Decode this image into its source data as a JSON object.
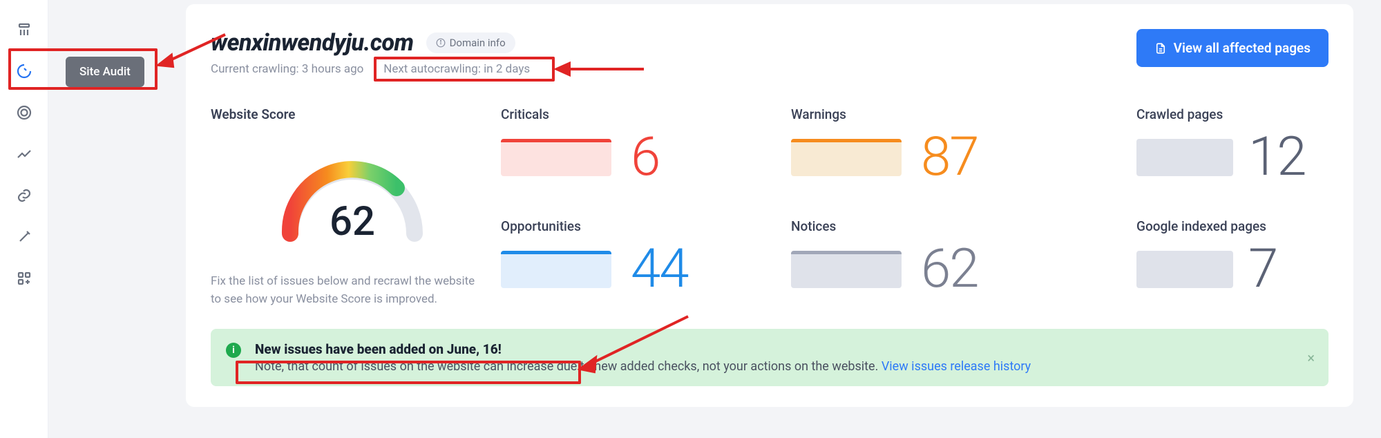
{
  "nav": {
    "tooltip": "Site Audit"
  },
  "header": {
    "domain": "wenxinwendyju.com",
    "domain_info_label": "Domain info",
    "current_crawl_label": "Current crawling:",
    "current_crawl_value": "3 hours ago",
    "next_crawl_label": "Next autocrawling:",
    "next_crawl_value": "in 2 days",
    "view_all_btn": "View all affected pages"
  },
  "metrics": {
    "criticals": {
      "label": "Criticals",
      "value": "6"
    },
    "warnings": {
      "label": "Warnings",
      "value": "87"
    },
    "opportunities": {
      "label": "Opportunities",
      "value": "44"
    },
    "notices": {
      "label": "Notices",
      "value": "62"
    },
    "score": {
      "label": "Website Score",
      "value": "62",
      "description": "Fix the list of issues below and recrawl the website to see how your Website Score is improved."
    },
    "crawled": {
      "label": "Crawled pages",
      "value": "12"
    },
    "indexed": {
      "label": "Google indexed pages",
      "value": "7"
    }
  },
  "banner": {
    "title": "New issues have been added on June, 16!",
    "text": "Note, that count of issues on the website can increase due to new added checks, not your actions on the website. ",
    "link": "View issues release history"
  },
  "chart_data": {
    "type": "gauge",
    "title": "Website Score",
    "value": 62,
    "min": 0,
    "max": 100,
    "segments": [
      {
        "range": [
          0,
          40
        ],
        "color": "#f0433a"
      },
      {
        "range": [
          40,
          55
        ],
        "color": "#f68c1e"
      },
      {
        "range": [
          55,
          70
        ],
        "color": "#f8cf3a"
      },
      {
        "range": [
          70,
          100
        ],
        "color": "#3cc06a"
      }
    ]
  }
}
